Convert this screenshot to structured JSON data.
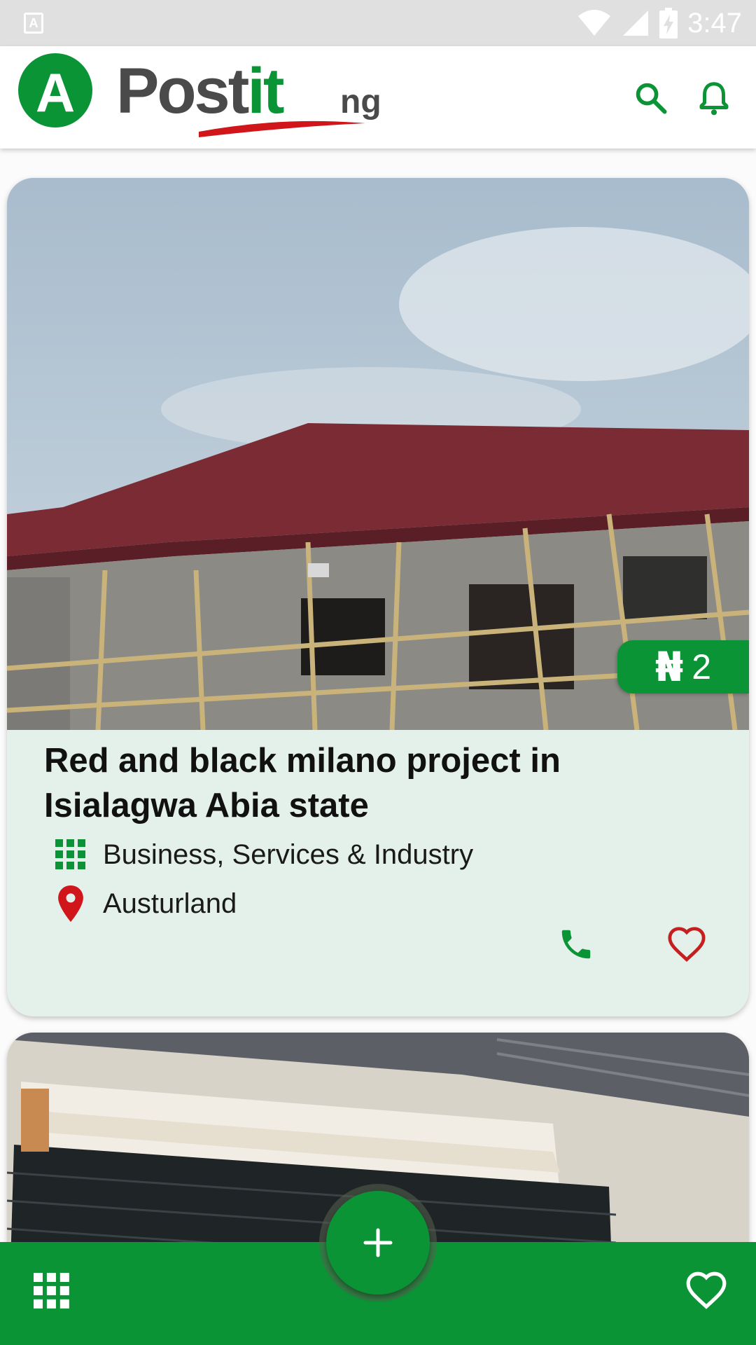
{
  "status_bar": {
    "time": "3:47",
    "notification_icon": "a-icon",
    "icons": [
      "wifi-icon",
      "signal-icon",
      "battery-charging-icon"
    ]
  },
  "app_bar": {
    "avatar_letter": "A",
    "logo_text_main": "Post",
    "logo_text_accent": "it",
    "logo_text_tld": "ng",
    "actions": [
      "search-icon",
      "bell-icon"
    ]
  },
  "listings": [
    {
      "title": "Red and black milano project in Isialagwa Abia state",
      "price_currency": "₦",
      "price_value": "2",
      "category": "Business, Services & Industry",
      "location": "Austurland",
      "actions": [
        "phone-icon",
        "heart-outline-icon"
      ]
    },
    {
      "image": "roofing-sheets-photo"
    }
  ],
  "bottom_nav": {
    "left_icon": "grid-icon",
    "fab_icon": "plus-icon",
    "right_icon": "heart-outline-icon"
  },
  "colors": {
    "brand_green": "#0a9436",
    "card_background": "#e4f1ea",
    "location_red": "#d0161b",
    "favorite_red": "#c61f1f"
  }
}
